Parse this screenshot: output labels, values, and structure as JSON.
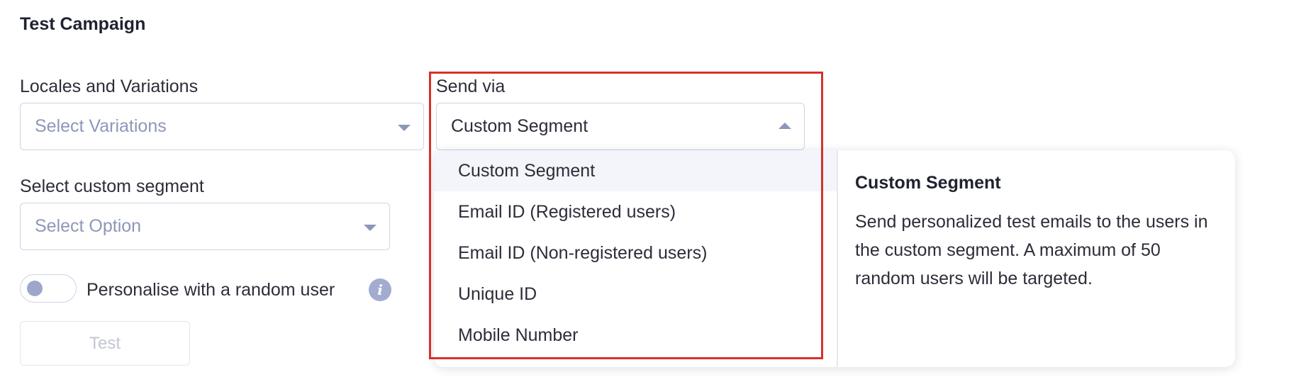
{
  "section": {
    "title": "Test Campaign"
  },
  "locales": {
    "label": "Locales and Variations",
    "placeholder": "Select Variations",
    "icon": "chevron-down-icon"
  },
  "send_via": {
    "label": "Send via",
    "value": "Custom Segment",
    "icon": "chevron-up-icon",
    "options": [
      "Custom Segment",
      "Email ID (Registered users)",
      "Email ID (Non-registered users)",
      "Unique ID",
      "Mobile Number"
    ],
    "active_index": 0,
    "description": {
      "title": "Custom Segment",
      "body": "Send personalized test emails to the users in the custom segment. A maximum of 50 random users will be targeted."
    }
  },
  "segment": {
    "label": "Select custom segment",
    "placeholder": "Select Option",
    "icon": "chevron-down-icon"
  },
  "personalise": {
    "label": "Personalise with a random user",
    "enabled": false,
    "info_icon": "info-icon"
  },
  "test_button": {
    "label": "Test",
    "disabled": true
  },
  "colors": {
    "highlight": "#d5322b",
    "placeholder": "#8e97b8",
    "border": "#cfd4e6",
    "active_option_bg": "#f4f5fb"
  }
}
